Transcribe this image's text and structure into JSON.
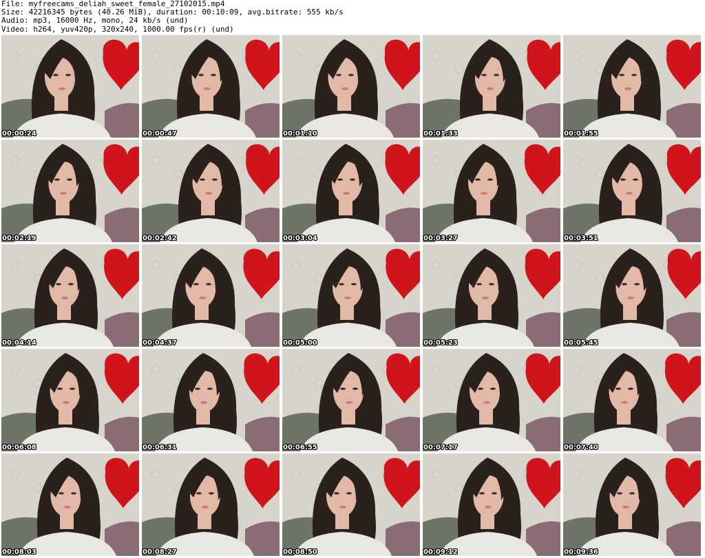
{
  "header": {
    "file_line": "File: myfreecams_deliah_sweet_female_27102015.mp4",
    "size_line": "Size: 42216345 bytes (40.26 MiB), duration: 00:10:09, avg.bitrate: 555 kb/s",
    "audio_line": "Audio: mp3, 16000 Hz, mono, 24 kb/s (und)",
    "video_line": "Video: h264, yuv420p, 320x240, 1000.00 fps(r) (und)"
  },
  "thumbnails": [
    {
      "time": "00:00:24",
      "scene": "woman-with-red-heart-pillow"
    },
    {
      "time": "00:00:47",
      "scene": "woman-with-red-heart-pillow"
    },
    {
      "time": "00:01:10",
      "scene": "woman-with-red-heart-pillow"
    },
    {
      "time": "00:01:33",
      "scene": "woman-with-red-heart-pillow"
    },
    {
      "time": "00:01:55",
      "scene": "woman-with-red-heart-pillow"
    },
    {
      "time": "00:02:19",
      "scene": "woman-with-red-heart-pillow"
    },
    {
      "time": "00:02:42",
      "scene": "woman-with-red-heart-pillow"
    },
    {
      "time": "00:03:04",
      "scene": "woman-with-red-heart-pillow"
    },
    {
      "time": "00:03:27",
      "scene": "woman-with-red-heart-pillow"
    },
    {
      "time": "00:03:51",
      "scene": "woman-with-red-heart-pillow"
    },
    {
      "time": "00:04:14",
      "scene": "woman-with-red-heart-pillow"
    },
    {
      "time": "00:04:37",
      "scene": "woman-with-red-heart-pillow"
    },
    {
      "time": "00:05:00",
      "scene": "woman-with-red-heart-pillow"
    },
    {
      "time": "00:05:23",
      "scene": "woman-with-red-heart-pillow"
    },
    {
      "time": "00:05:45",
      "scene": "woman-with-red-heart-pillow"
    },
    {
      "time": "00:06:08",
      "scene": "woman-with-red-heart-pillow"
    },
    {
      "time": "00:06:31",
      "scene": "woman-with-red-heart-pillow"
    },
    {
      "time": "00:06:55",
      "scene": "woman-with-red-heart-pillow"
    },
    {
      "time": "00:07:17",
      "scene": "woman-with-red-heart-pillow"
    },
    {
      "time": "00:07:40",
      "scene": "woman-with-red-heart-pillow"
    },
    {
      "time": "00:08:03",
      "scene": "woman-with-red-heart-pillow"
    },
    {
      "time": "00:08:27",
      "scene": "woman-with-red-heart-pillow"
    },
    {
      "time": "00:08:50",
      "scene": "woman-with-red-heart-pillow"
    },
    {
      "time": "00:09:12",
      "scene": "woman-with-red-heart-pillow"
    },
    {
      "time": "00:09:36",
      "scene": "woman-with-red-heart-pillow"
    }
  ],
  "colors": {
    "background": "#ffffff",
    "wall": "#d6d4cb",
    "heart": "#d0141c",
    "hair": "#2a211d",
    "skin": "#e2b9a6",
    "shirt": "#e9e7e2",
    "cushion": "#6f7566"
  }
}
